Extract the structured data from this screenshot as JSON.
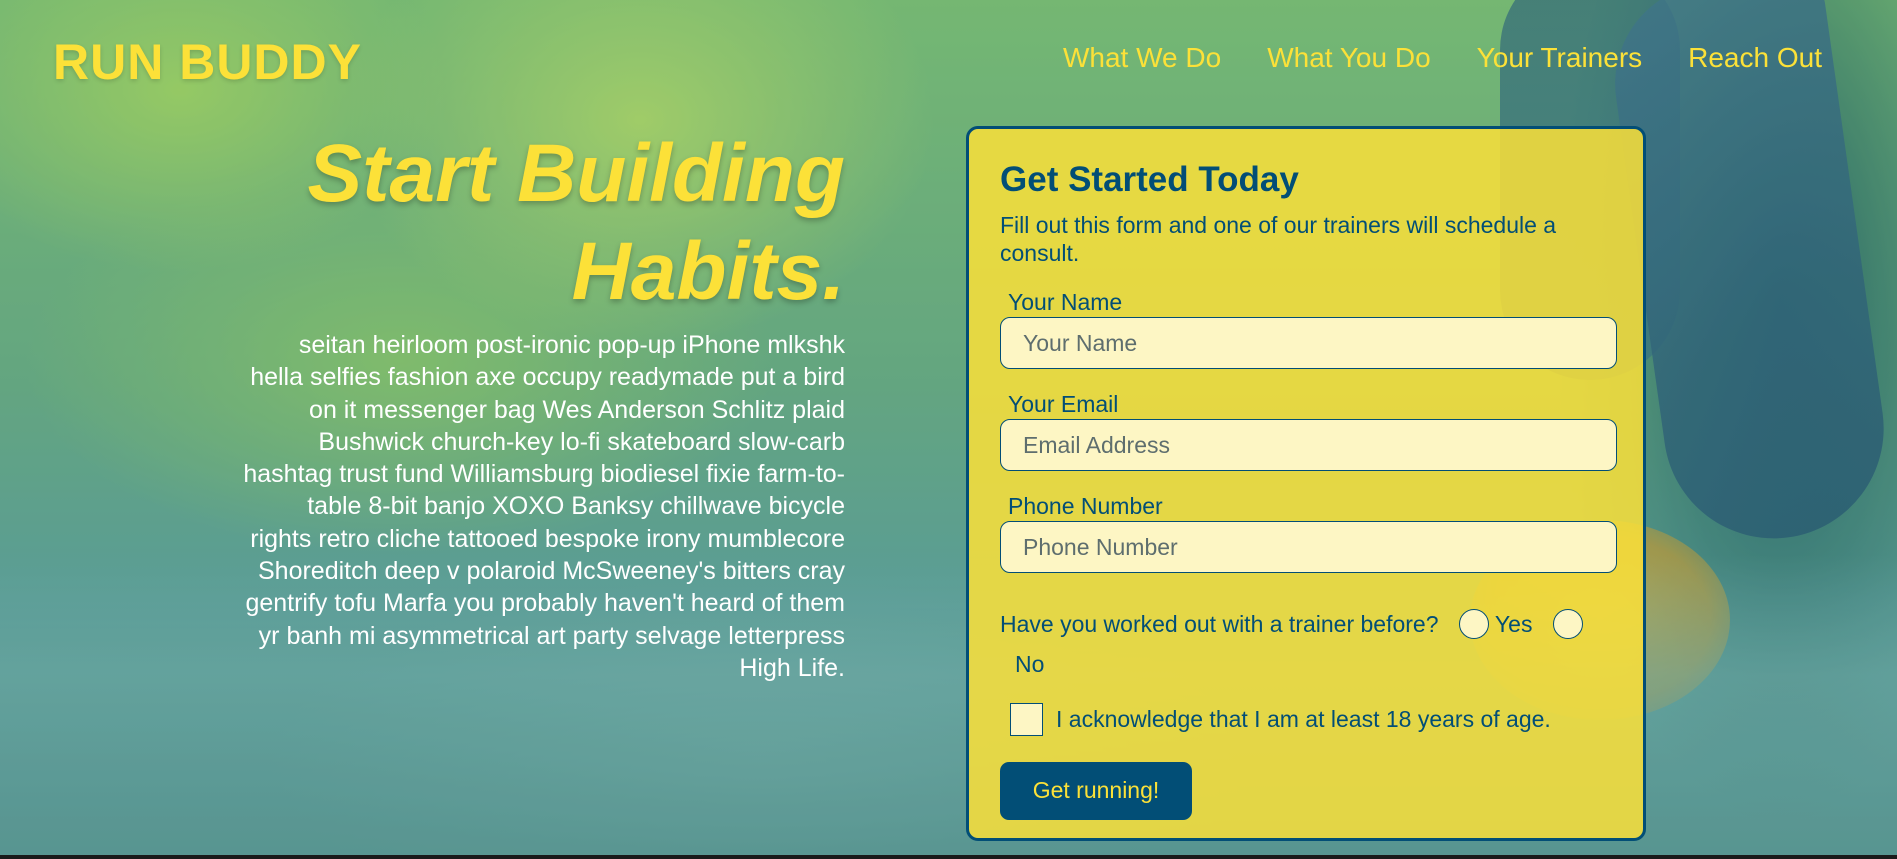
{
  "header": {
    "logo": "RUN BUDDY",
    "nav": [
      {
        "label": "What We Do"
      },
      {
        "label": "What You Do"
      },
      {
        "label": "Your Trainers"
      },
      {
        "label": "Reach Out"
      }
    ]
  },
  "hero": {
    "title_line1": "Start Building",
    "title_line2": "Habits.",
    "copy": "seitan heirloom post-ironic pop-up iPhone mlkshk hella selfies fashion axe occupy readymade put a bird on it messenger bag Wes Anderson Schlitz plaid Bushwick church-key lo-fi skateboard slow-carb hashtag trust fund Williamsburg biodiesel fixie farm-to-table 8-bit banjo XOXO Banksy chillwave bicycle rights retro cliche tattooed bespoke irony mumblecore Shoreditch deep v polaroid McSweeney's bitters cray gentrify tofu Marfa you probably haven't heard of them yr banh mi asymmetrical art party selvage letterpress High Life."
  },
  "form": {
    "title": "Get Started Today",
    "intro": "Fill out this form and one of our trainers will schedule a consult.",
    "name_label": "Your Name",
    "name_placeholder": "Your Name",
    "name_value": "",
    "email_label": "Your Email",
    "email_placeholder": "Email Address",
    "email_value": "",
    "phone_label": "Phone Number",
    "phone_placeholder": "Phone Number",
    "phone_value": "",
    "trainer_question": "Have you worked out with a trainer before?",
    "option_yes": "Yes",
    "option_no": "No",
    "ack_label": "I acknowledge that I am at least 18 years of age.",
    "submit_label": "Get running!"
  },
  "colors": {
    "brand_yellow": "#fce138",
    "brand_blue": "#024e76"
  }
}
